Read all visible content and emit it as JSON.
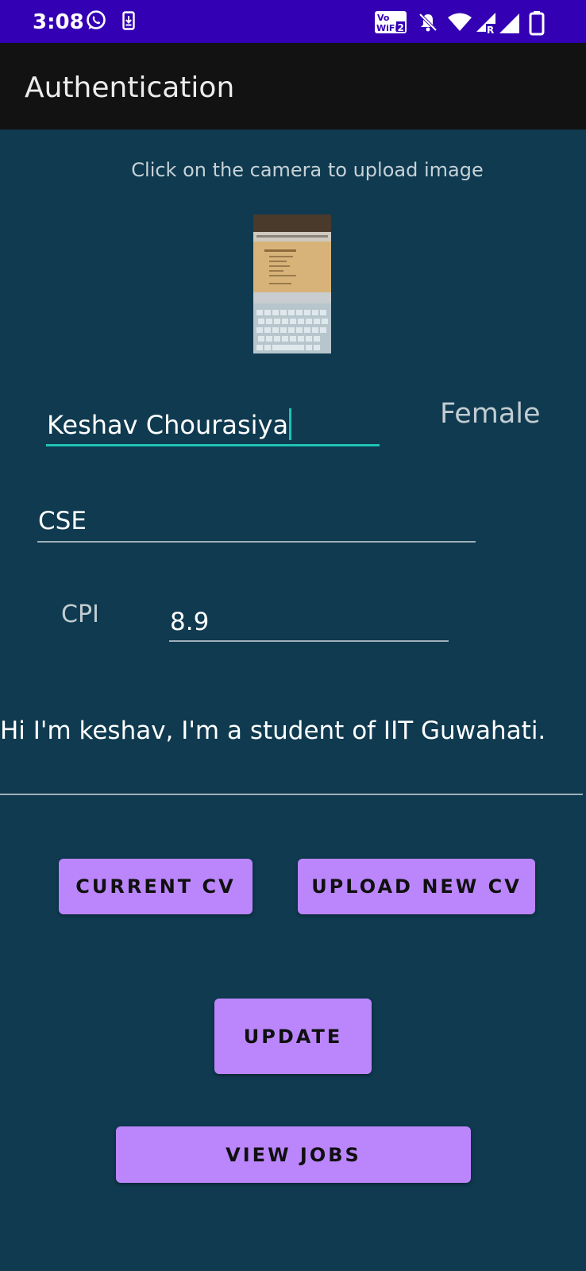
{
  "status_bar": {
    "time": "3:08",
    "icons": [
      "whatsapp-icon",
      "download-icon",
      "vowifi2-icon",
      "notifications-off-icon",
      "wifi-icon",
      "signal-roaming-icon",
      "signal-icon",
      "battery-icon"
    ],
    "vowifi_text": "Vo WiFi 2",
    "roaming_text": "R"
  },
  "app_bar": {
    "title": "Authentication"
  },
  "profile": {
    "hint": "Click on the camera to upload image",
    "name": "Keshav Chourasiya",
    "gender": "Female",
    "branch": "CSE",
    "cpi_label": "CPI",
    "cpi": "8.9",
    "bio": "Hi I'm keshav, I'm a student of IIT Guwahati."
  },
  "buttons": {
    "current_cv": "CURRENT CV",
    "upload_new_cv": "UPLOAD NEW CV",
    "update": "UPDATE",
    "view_jobs": "VIEW JOBS"
  },
  "colors": {
    "status_bar": "#3300b3",
    "app_bar": "#121212",
    "background": "#0f3a4f",
    "button": "#bb86fc",
    "accent": "#1fc3b5"
  }
}
